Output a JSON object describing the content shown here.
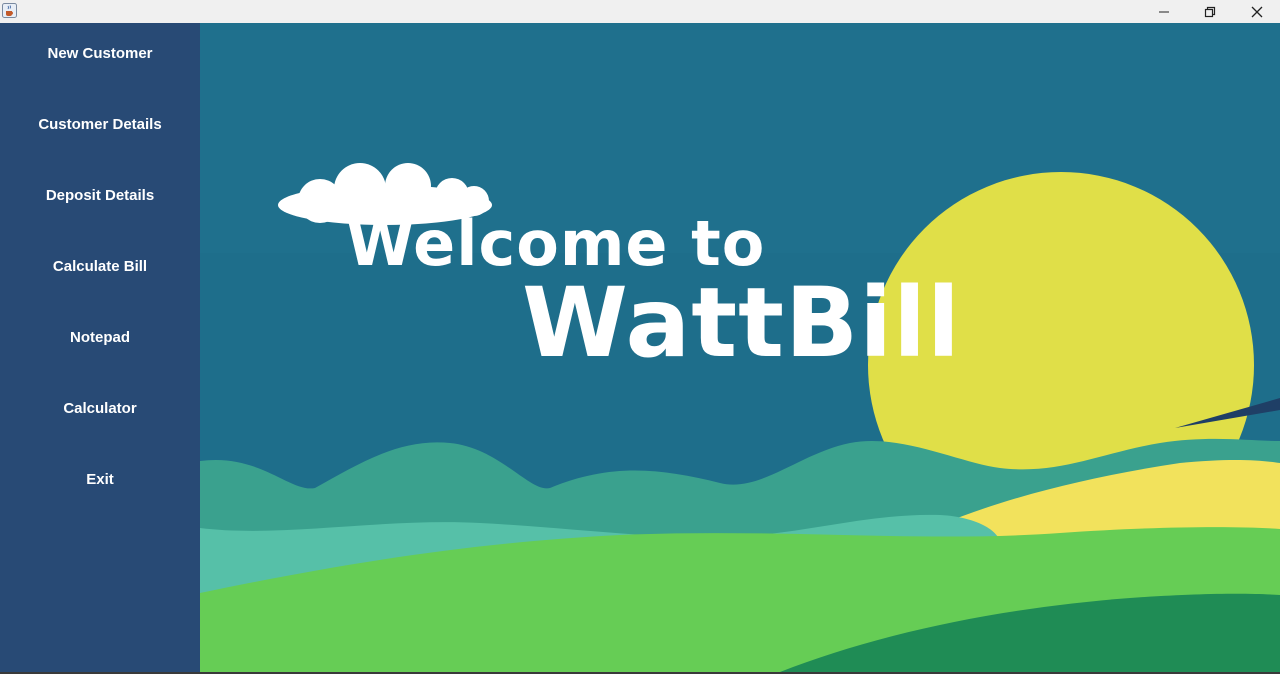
{
  "window": {
    "app_icon": "java-cup-icon",
    "controls": {
      "minimize": "minimize-icon",
      "maximize": "restore-icon",
      "close": "close-icon"
    }
  },
  "sidebar": {
    "items": [
      {
        "label": "New Customer"
      },
      {
        "label": "Customer Details"
      },
      {
        "label": "Deposit Details"
      },
      {
        "label": "Calculate Bill"
      },
      {
        "label": "Notepad"
      },
      {
        "label": "Calculator"
      },
      {
        "label": "Exit"
      }
    ]
  },
  "banner": {
    "line1": "Welcome to",
    "line2": "WattBill"
  },
  "colors": {
    "sidebar": "#284a75",
    "sky": "#1e6f8c",
    "sun": "#dcdc48",
    "hill_dark": "#3aa18e",
    "hill_mid": "#5cc2aa",
    "grass": "#66ce54",
    "grass_dark": "#1f8c55",
    "sand": "#f2e25c"
  }
}
